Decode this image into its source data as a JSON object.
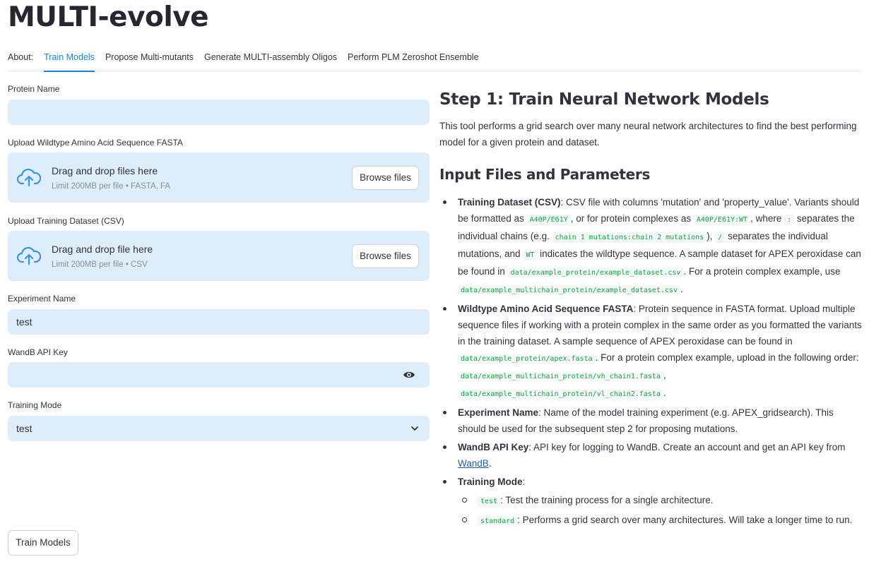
{
  "app": {
    "title": "MULTI-evolve"
  },
  "tabs": [
    {
      "label": "About:"
    },
    {
      "label": "Train Models",
      "active": true
    },
    {
      "label": "Propose Multi-mutants"
    },
    {
      "label": "Generate MULTI-assembly Oligos"
    },
    {
      "label": "Perform PLM Zeroshot Ensemble"
    }
  ],
  "form": {
    "protein_name": {
      "label": "Protein Name",
      "value": ""
    },
    "fasta_upload": {
      "label": "Upload Wildtype Amino Acid Sequence FASTA",
      "drop_text": "Drag and drop files here",
      "limit_text": "Limit 200MB per file • FASTA, FA",
      "browse_label": "Browse files"
    },
    "csv_upload": {
      "label": "Upload Training Dataset (CSV)",
      "drop_text": "Drag and drop file here",
      "limit_text": "Limit 200MB per file • CSV",
      "browse_label": "Browse files"
    },
    "experiment_name": {
      "label": "Experiment Name",
      "value": "test"
    },
    "wandb_key": {
      "label": "WandB API Key",
      "value": ""
    },
    "training_mode": {
      "label": "Training Mode",
      "selected": "test"
    },
    "submit_label": "Train Models"
  },
  "doc": {
    "heading": "Step 1: Train Neural Network Models",
    "intro": "This tool performs a grid search over many neural network architectures to find the best performing model for a given protein and dataset.",
    "subheading": "Input Files and Parameters",
    "items": {
      "dataset": {
        "title": "Training Dataset (CSV)",
        "t1": ": CSV file with columns 'mutation' and 'property_value'. Variants should be formatted as ",
        "c1": "A40P/E61Y",
        "t2": ", or for protein complexes as ",
        "c2": "A40P/E61Y:WT",
        "t3": ", where ",
        "c3": ":",
        "t4": " separates the individual chains (e.g. ",
        "c4": "chain 1 mutations:chain 2 mutations",
        "t5": "), ",
        "c5": "/",
        "t6": " separates the individual mutations, and ",
        "c6": "WT",
        "t7": " indicates the wildtype sequence. A sample dataset for APEX peroxidase can be found in ",
        "c7": "data/example_protein/example_dataset.csv",
        "t8": ". For a protein complex example, use ",
        "c8": "data/example_multichain_protein/example_dataset.csv",
        "t9": "."
      },
      "fasta": {
        "title": "Wildtype Amino Acid Sequence FASTA",
        "t1": ": Protein sequence in FASTA format. Upload multiple sequence files if working with a protein complex in the same order as you formatted the variants in the training dataset. A sample sequence of APEX peroxidase can be found in ",
        "c1": "data/example_protein/apex.fasta",
        "t2": ". For a protein complex example, upload in the following order: ",
        "c2": "data/example_multichain_protein/vh_chain1.fasta",
        "t3": ", ",
        "c3": "data/example_multichain_protein/vl_chain2.fasta",
        "t4": "."
      },
      "experiment": {
        "title": "Experiment Name",
        "t1": ": Name of the model training experiment (e.g. APEX_gridsearch). This should be used for the subsequent step 2 for proposing mutations."
      },
      "wandb": {
        "title": "WandB API Key",
        "t1": ": API key for logging to WandB. Create an account and get an API key from ",
        "link": "WandB",
        "t2": "."
      },
      "mode": {
        "title": "Training Mode",
        "t1": ":",
        "opt1_code": "test",
        "opt1_text": ": Test the training process for a single architecture.",
        "opt2_code": "standard",
        "opt2_text": ": Performs a grid search over many architectures. Will take a longer time to run."
      }
    }
  },
  "colors": {
    "accent": "#1c83e1",
    "input_bg": "#ddedf9",
    "code_text": "#09ab3b"
  },
  "icons": [
    "cloud-upload-icon",
    "eye-icon",
    "chevron-down-icon"
  ]
}
